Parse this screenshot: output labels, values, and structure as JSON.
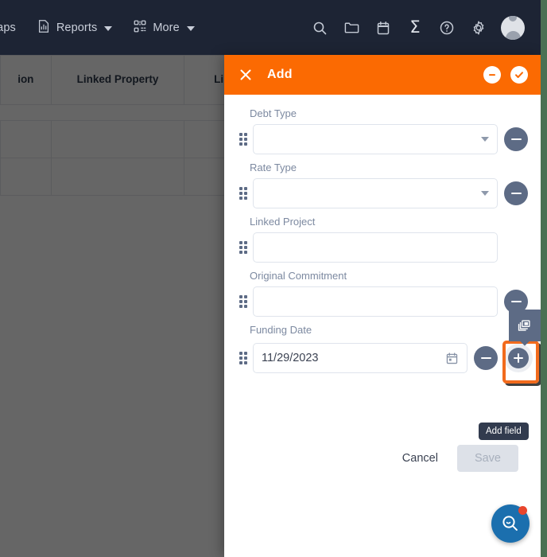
{
  "topnav": {
    "items": [
      {
        "label": "Maps",
        "icon": "map-icon",
        "has_caret": false
      },
      {
        "label": "Reports",
        "icon": "report-chart-icon",
        "has_caret": true
      },
      {
        "label": "More",
        "icon": "qr-grid-icon",
        "has_caret": true
      }
    ],
    "actions": [
      {
        "name": "search-icon"
      },
      {
        "name": "folder-icon"
      },
      {
        "name": "calendar-icon"
      },
      {
        "name": "sigma-icon",
        "glyph": "Σ"
      },
      {
        "name": "help-icon"
      },
      {
        "name": "gear-icon"
      },
      {
        "name": "avatar"
      }
    ],
    "background": "#1d2434"
  },
  "background_table": {
    "headers": [
      "ion",
      "Linked Property",
      "Linked Project"
    ],
    "rows": [
      [
        "",
        "",
        ""
      ],
      [
        "",
        "",
        ""
      ]
    ]
  },
  "modal": {
    "title": "Add",
    "header_color": "#fb6a02",
    "close_label": "Close",
    "collapse_label": "Collapse",
    "confirm_label": "Confirm",
    "fields": [
      {
        "label": "Debt Type",
        "value": "",
        "control": "dropdown",
        "removable": true
      },
      {
        "label": "Rate Type",
        "value": "",
        "control": "dropdown",
        "removable": true
      },
      {
        "label": "Linked Project",
        "value": "",
        "control": "text",
        "removable": true
      },
      {
        "label": "Original Commitment",
        "value": "",
        "control": "text",
        "removable": true
      },
      {
        "label": "Funding Date",
        "value": "11/29/2023",
        "control": "date",
        "removable": true
      }
    ],
    "duplicate_tool": {
      "name": "duplicate-icon"
    },
    "add_field_tooltip": "Add field",
    "footer": {
      "cancel_label": "Cancel",
      "save_label": "Save",
      "save_disabled": true
    }
  },
  "fab": {
    "name": "search-assistant-fab",
    "has_notification": true,
    "color": "#1b6fae",
    "dot_color": "#e8452c"
  },
  "edge_strip_color": "#4a7053"
}
